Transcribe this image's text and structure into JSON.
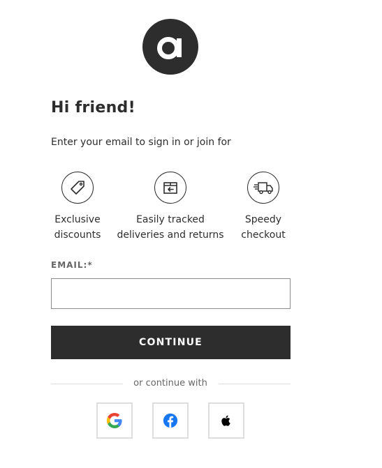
{
  "brand": {
    "logo_letter": "a",
    "logo_color": "#2d2d2d"
  },
  "header": {
    "title": "Hi friend!",
    "subtitle": "Enter your email to sign in or join for"
  },
  "benefits": [
    {
      "icon": "price-tag-icon",
      "line1": "Exclusive",
      "line2": "discounts"
    },
    {
      "icon": "return-box-icon",
      "line1": "Easily tracked",
      "line2": "deliveries and returns"
    },
    {
      "icon": "delivery-truck-icon",
      "line1": "Speedy",
      "line2": "checkout"
    }
  ],
  "form": {
    "email_label": "EMAIL:*",
    "email_value": "",
    "email_placeholder": "",
    "continue_label": "CONTINUE"
  },
  "social": {
    "divider_text": "or continue with",
    "providers": [
      {
        "name": "google",
        "icon": "google-icon"
      },
      {
        "name": "facebook",
        "icon": "facebook-icon",
        "color": "#1877f2"
      },
      {
        "name": "apple",
        "icon": "apple-icon"
      }
    ]
  },
  "colors": {
    "primary": "#2d2d2d",
    "muted": "#666666",
    "border": "#dddddd"
  }
}
